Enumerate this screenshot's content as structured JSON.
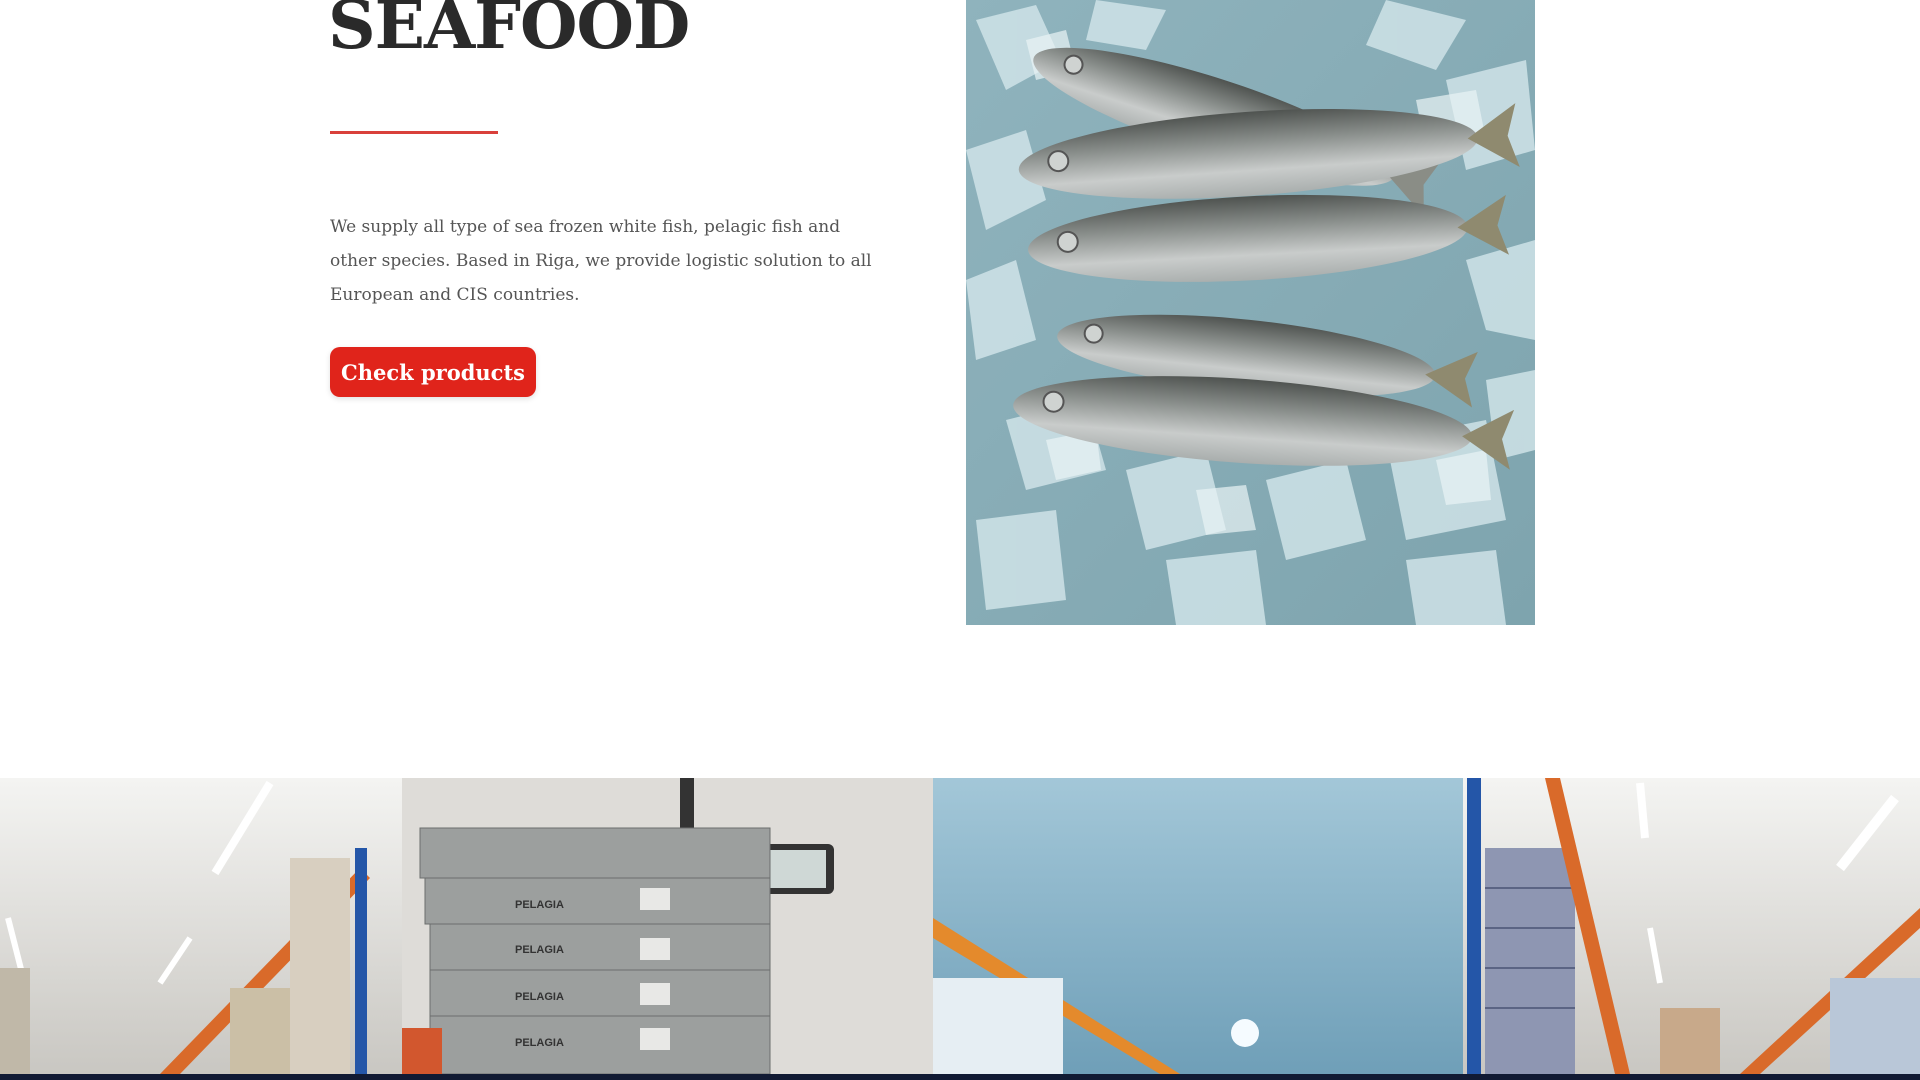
{
  "hero": {
    "title": "SEAFOOD",
    "description": "We supply all type of sea frozen white fish, pelagic fish and other species. Based in Riga, we provide logistic solution to all European and CIS countries.",
    "cta_label": "Check products"
  },
  "images": {
    "fish_photo": "frozen-fish-on-ice-photo",
    "warehouse_strip": "cold-storage-warehouse-photos"
  },
  "crate_labels": {
    "brand": "PELAGIA"
  },
  "colors": {
    "accent": "#e0241b",
    "rule": "#d9403b",
    "title": "#2a2a2a",
    "body_text": "#555555"
  }
}
